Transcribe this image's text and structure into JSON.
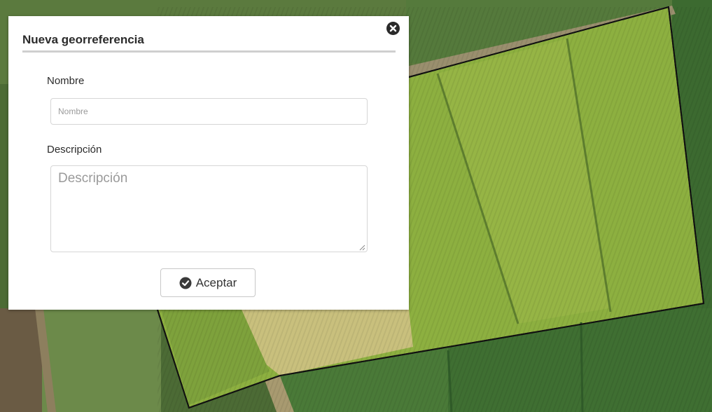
{
  "dialog": {
    "title": "Nueva georreferencia",
    "close_icon": "close-circle-icon",
    "fields": {
      "nombre": {
        "label": "Nombre",
        "value": "",
        "placeholder": "Nombre"
      },
      "descripcion": {
        "label": "Descripción",
        "value": "",
        "placeholder": "Descripción"
      }
    },
    "accept_button": {
      "label": "Aceptar",
      "icon": "check-circle-icon"
    }
  },
  "map": {
    "layer": "satellite",
    "polygon_stroke": "#111111",
    "field_colors": [
      "#7fa83a",
      "#8ab43f",
      "#9bb84a",
      "#c7b978",
      "#6e9a35",
      "#3f6a2e"
    ]
  }
}
